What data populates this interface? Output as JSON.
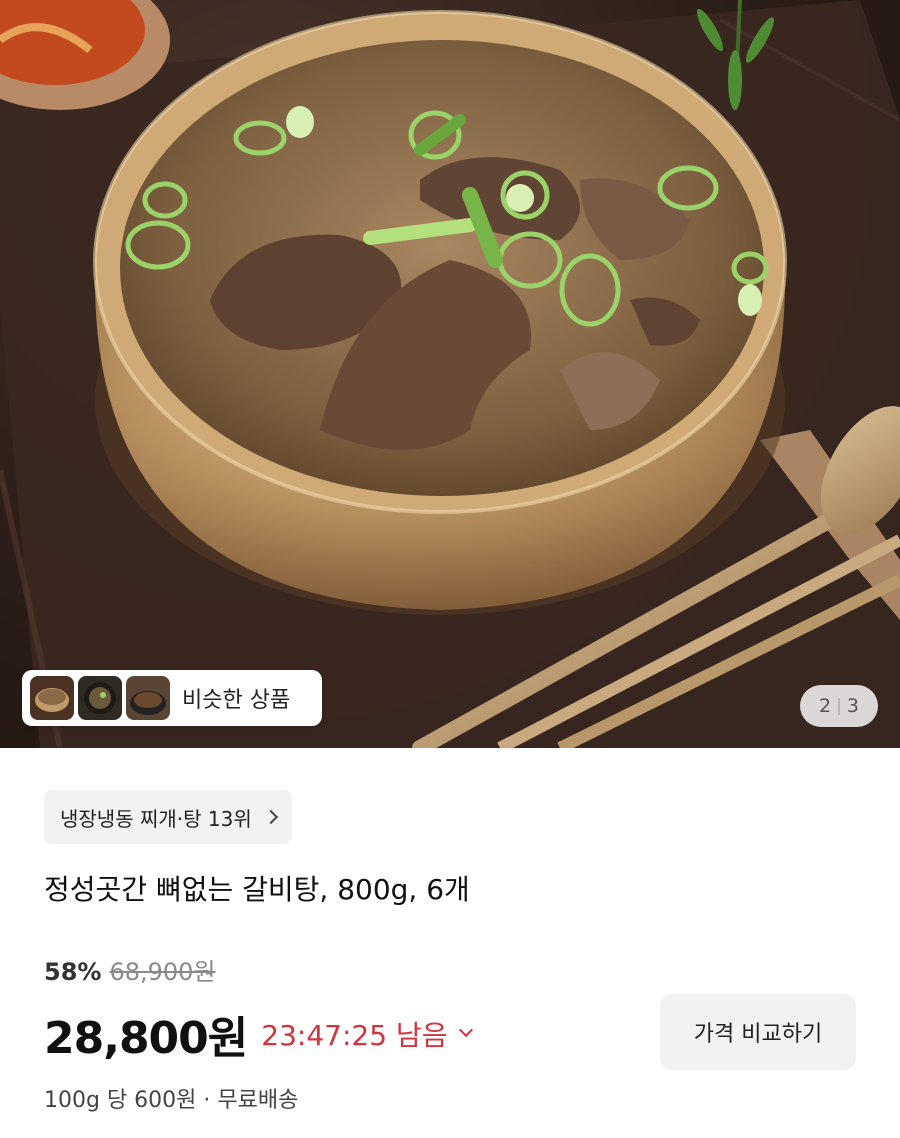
{
  "hero": {
    "similar_products_label": "비슷한 상품",
    "similar_thumbnails": [
      "thumb-galbitang-1",
      "thumb-galbitang-2",
      "thumb-galbitang-3"
    ],
    "page_current": "2",
    "page_total": "3"
  },
  "product": {
    "category_rank": "냉장냉동 찌개·탕 13위",
    "title": "정성곳간 뼈없는 갈비탕, 800g, 6개",
    "discount_rate": "58%",
    "original_price": "68,900원",
    "price": "28,800원",
    "timer": "23:47:25 남음",
    "unit_price_shipping": "100g 당 600원 · 무료배송"
  },
  "actions": {
    "compare_label": "가격 비교하기"
  },
  "colors": {
    "timer_red": "#d2333d",
    "chip_bg": "#f1f2f4"
  }
}
